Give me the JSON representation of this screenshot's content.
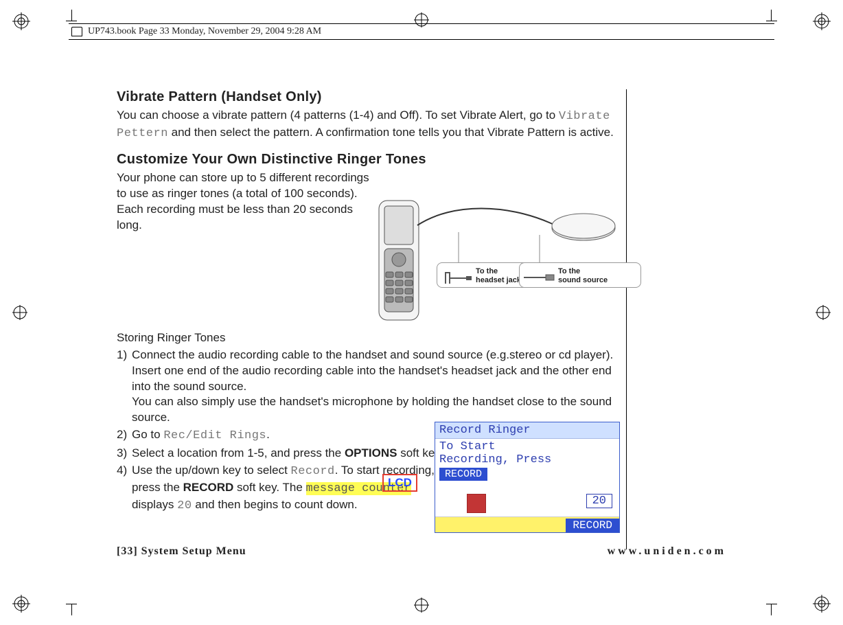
{
  "running_header": "UP743.book  Page 33  Monday, November 29, 2004  9:28 AM",
  "section1": {
    "title": "Vibrate Pattern (Handset Only)",
    "text_pre": "You can choose a vibrate pattern (4 patterns (1-4) and Off). To set Vibrate Alert, go to ",
    "menu": "Vibrate Pettern",
    "text_post": " and then select the pattern. A confirmation tone tells you that Vibrate Pattern is active."
  },
  "section2": {
    "title": "Customize Your Own Distinctive Ringer Tones",
    "lead": "Your phone can store up to 5 different recordings to use as ringer tones (a total of 100 seconds). Each recording must be less than 20 seconds long."
  },
  "callouts": {
    "left": "To the\nheadset jack",
    "right": "To the\nsound source"
  },
  "sub": "Storing Ringer Tones",
  "steps": {
    "s1a": "Connect the audio recording cable to the handset and sound source (e.g.stereo or cd player). Insert one end of the audio recording cable into the handset's headset jack and the other end into the sound source.",
    "s1b": "You can also simply use the handset's microphone by holding the handset close to the sound source.",
    "s2_pre": "Go to ",
    "s2_code": "Rec/Edit Rings",
    "s2_post": ".",
    "s3_pre": "Select a location from 1-5, and press the ",
    "s3_bold": "OPTIONS",
    "s3_post": " soft key.",
    "s4_pre": "Use the up/down key to select ",
    "s4_code1": "Record",
    "s4_mid1": ". To start recording, press the ",
    "s4_bold": "RECORD",
    "s4_mid2": " soft key. The ",
    "s4_hl": "message counter",
    "s4_mid3": " displays ",
    "s4_code2": "20",
    "s4_post": " and then begins to count down."
  },
  "lcd_overlay": "LCD",
  "lcd": {
    "title": " Record Ringer",
    "line1": "To Start",
    "line2": "Recording, Press",
    "btn": "RECORD",
    "count": "20",
    "footer_btn": "RECORD"
  },
  "footer": {
    "left": "[33] System Setup Menu",
    "right": "www.uniden.com"
  }
}
